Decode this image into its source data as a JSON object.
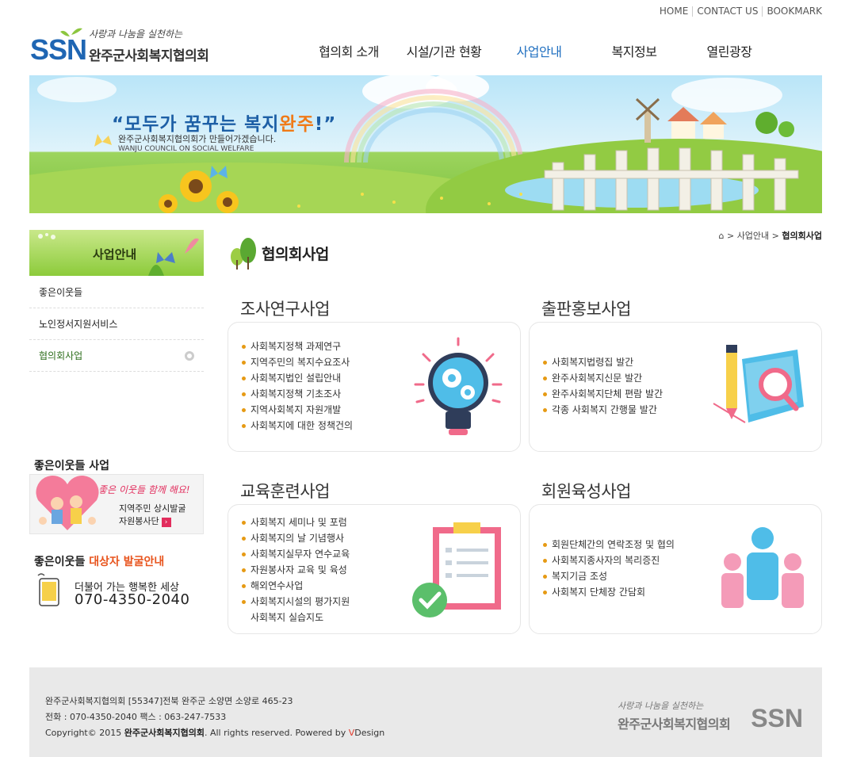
{
  "util_links": [
    "HOME",
    "CONTACT US",
    "BOOKMARK"
  ],
  "logo": {
    "ssn": "SSN",
    "tagline": "사랑과 나눔을 실천하는",
    "name": "완주군사회복지협의회"
  },
  "gnb": [
    "협의회 소개",
    "시설/기관 현황",
    "사업안내",
    "복지정보",
    "열린광장"
  ],
  "gnb_active": "사업안내",
  "banner": {
    "slogan_pre": "“모두가 꿈꾸는 복지",
    "slogan_hl": "완주",
    "slogan_post": "!”",
    "sub1": "완주군사회복지협의회가 만들어가겠습니다.",
    "sub2": "WANJU COUNCIL ON SOCIAL WELFARE"
  },
  "sidebar": {
    "title": "사업안내",
    "items": [
      {
        "label": "좋은이웃들"
      },
      {
        "label": "노인정서지원서비스"
      },
      {
        "label": "협의회사업"
      }
    ]
  },
  "neighbors": {
    "title": "좋은이웃들 사업",
    "slogan": "좋은 이웃들 함께 해요!",
    "line1": "지역주민 상시발굴",
    "line2": "자원봉사단"
  },
  "guide": {
    "title_pre": "좋은이웃들 ",
    "title_accent": "대상자 발굴안내",
    "message": "더불어 가는 행복한 세상",
    "phone": "070-4350-2040"
  },
  "breadcrumb": {
    "path1": "사업안내",
    "current": "협의회사업"
  },
  "page_title": "협의회사업",
  "sections": [
    {
      "title": "조사연구사업",
      "items": [
        "사회복지정책 과제연구",
        "지역주민의 복지수요조사",
        "사회복지법인 설립안내",
        "사회복지정책 기초조사",
        "지역사회복지 자원개발",
        "사회복지에 대한 정책건의"
      ]
    },
    {
      "title": "출판홍보사업",
      "items": [
        "사회복지법령집 발간",
        "완주사회복지신문 발간",
        "완주사회복지단체 편람 발간",
        "각종 사회복지 간행물 발간"
      ]
    },
    {
      "title": "교육훈련사업",
      "items": [
        "사회복지 세미나 및 포럼",
        "사회복지의 날 기념행사",
        "사회복지실무자 연수교육",
        "자원봉사자 교육 및 육성",
        "해외연수사업",
        "사회복지시설의 평가지원",
        "사회복지 실습지도"
      ]
    },
    {
      "title": "회원육성사업",
      "items": [
        "회원단체간의 연락조정 및 협의",
        "사회복지종사자의 복리증진",
        "복지기금 조성",
        "사회복지 단체장 간담회"
      ]
    }
  ],
  "footer": {
    "address": "완주군사회복지협의회 [55347]전북 완주군 소양면 소양로 465-23",
    "contact": "전화 : 070-4350-2040 팩스 : 063-247-7533",
    "copy_pre": "Copyright© 2015 ",
    "copy_org": "완주군사회복지협의회",
    "copy_mid": ". All rights reserved. Powered by ",
    "copy_v": "V",
    "copy_design": "Design"
  }
}
